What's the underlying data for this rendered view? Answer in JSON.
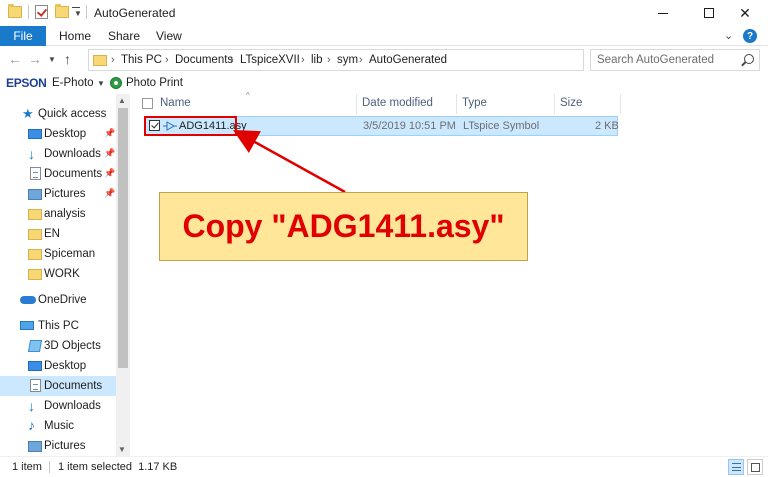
{
  "window": {
    "title": "AutoGenerated",
    "minimize": "—",
    "maximize": "□",
    "close": "✕"
  },
  "ribbon": {
    "tabs": [
      "File",
      "Home",
      "Share",
      "View"
    ],
    "collapse_icon": "chevron-down-icon",
    "help_label": "?"
  },
  "address": {
    "crumbs": [
      "This PC",
      "Documents",
      "LTspiceXVII",
      "lib",
      "sym",
      "AutoGenerated"
    ],
    "search_placeholder": "Search AutoGenerated"
  },
  "toolbar": {
    "brand": "EPSON",
    "ephoto_label": "E-Photo",
    "photoprint_label": "Photo Print"
  },
  "navpane": {
    "items": [
      {
        "label": "Quick access",
        "icon": "star-icon"
      },
      {
        "label": "Desktop",
        "icon": "desktop-icon",
        "pinned": true
      },
      {
        "label": "Downloads",
        "icon": "download-icon",
        "pinned": true
      },
      {
        "label": "Documents",
        "icon": "documents-icon",
        "pinned": true
      },
      {
        "label": "Pictures",
        "icon": "pictures-icon",
        "pinned": true
      },
      {
        "label": "analysis",
        "icon": "folder-icon"
      },
      {
        "label": "EN",
        "icon": "folder-icon"
      },
      {
        "label": "Spiceman",
        "icon": "folder-icon"
      },
      {
        "label": "WORK",
        "icon": "folder-icon"
      },
      {
        "label": "OneDrive",
        "icon": "cloud-icon"
      },
      {
        "label": "This PC",
        "icon": "pc-icon"
      },
      {
        "label": "3D Objects",
        "icon": "3d-objects-icon"
      },
      {
        "label": "Desktop",
        "icon": "desktop-icon"
      },
      {
        "label": "Documents",
        "icon": "documents-icon",
        "selected": true
      },
      {
        "label": "Downloads",
        "icon": "download-icon"
      },
      {
        "label": "Music",
        "icon": "music-icon"
      },
      {
        "label": "Pictures",
        "icon": "pictures-icon"
      }
    ]
  },
  "filelist": {
    "columns": [
      "Name",
      "Date modified",
      "Type",
      "Size"
    ],
    "rows": [
      {
        "name": "ADG1411.asy",
        "date": "3/5/2019 10:51 PM",
        "type": "LTspice Symbol",
        "size": "2 KB",
        "selected": true
      }
    ]
  },
  "callout": {
    "text": "Copy \"ADG1411.asy\"",
    "accent": "#e00000",
    "background": "#ffe699"
  },
  "status": {
    "count": "1 item",
    "selection": "1 item selected  1.17 KB"
  },
  "colors": {
    "file_tab": "#1979ca",
    "selection": "#cce8ff"
  }
}
